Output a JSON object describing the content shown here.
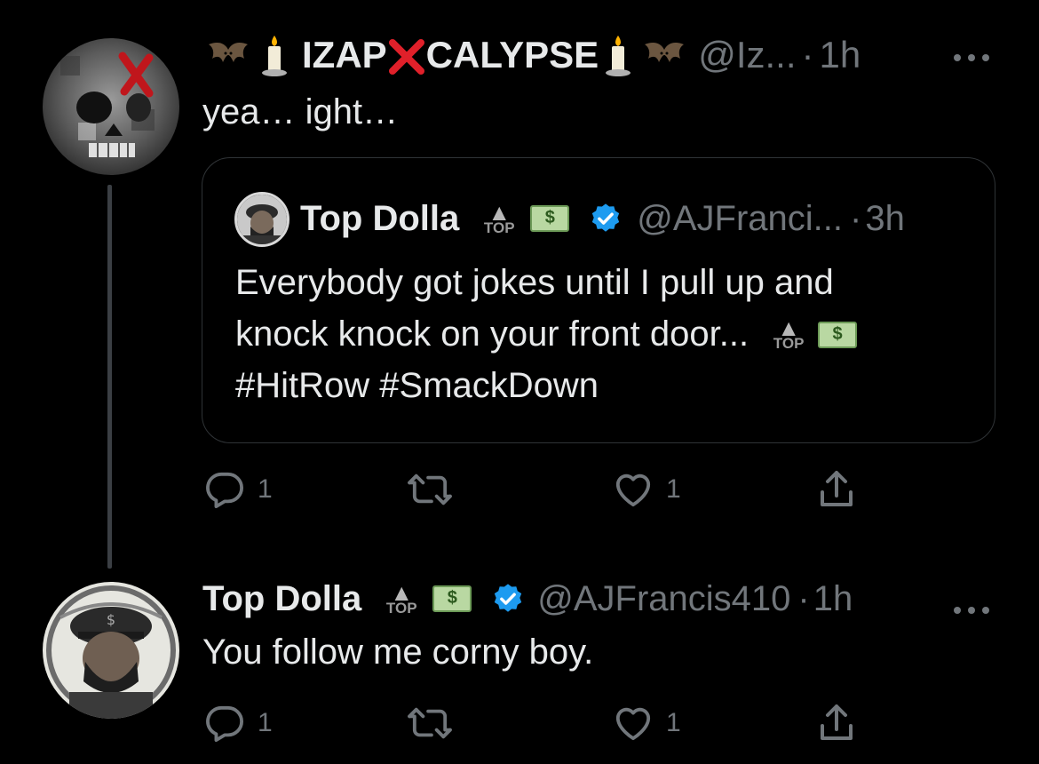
{
  "tweet1": {
    "display_name_left": "IZAP",
    "display_name_x": "❌",
    "display_name_right": "CALYPSE",
    "emoji_bat": "🦇",
    "emoji_candle": "🕯️",
    "handle": "@Iz...",
    "separator": "·",
    "time": "1h",
    "more": "···",
    "text": "yea… ight…",
    "quote": {
      "display_name": "Top Dolla",
      "top_label": "TOP",
      "handle": "@AJFranci...",
      "separator": "·",
      "time": "3h",
      "text_line1": "Everybody got jokes until I pull up and",
      "text_line2": "knock knock on your front door...",
      "text_line3": "#HitRow #SmackDown",
      "top_label_inline": "TOP"
    },
    "actions": {
      "reply_count": "1",
      "retweet_count": "",
      "like_count": "1",
      "share_count": ""
    }
  },
  "tweet2": {
    "display_name": "Top Dolla",
    "top_label": "TOP",
    "handle": "@AJFrancis410",
    "separator": "·",
    "time": "1h",
    "more": "···",
    "text": "You follow me corny boy.",
    "actions": {
      "reply_count": "1",
      "retweet_count": "",
      "like_count": "1",
      "share_count": ""
    }
  },
  "colors": {
    "background": "#000000",
    "text": "#e7e9ea",
    "secondary": "#71767b",
    "verified": "#1d9bf0",
    "border": "#2f3336"
  },
  "icons": [
    "reply-icon",
    "retweet-icon",
    "like-icon",
    "share-icon",
    "verified-badge-icon",
    "more-icon"
  ]
}
